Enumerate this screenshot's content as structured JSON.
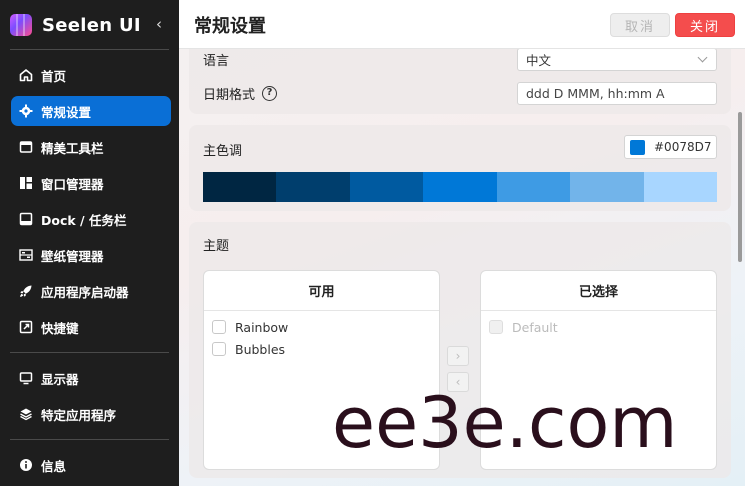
{
  "app": {
    "name": "Seelen UI",
    "collapse_icon": "chevron-left-icon"
  },
  "sidebar": {
    "items": [
      {
        "label": "首页",
        "icon": "home-icon",
        "active": false
      },
      {
        "label": "常规设置",
        "icon": "gear-icon",
        "active": true
      },
      {
        "label": "精美工具栏",
        "icon": "toolbar-icon",
        "active": false
      },
      {
        "label": "窗口管理器",
        "icon": "window-manager-icon",
        "active": false
      },
      {
        "label": "Dock / 任务栏",
        "icon": "dock-icon",
        "active": false
      },
      {
        "label": "壁纸管理器",
        "icon": "wallpaper-icon",
        "active": false
      },
      {
        "label": "应用程序启动器",
        "icon": "rocket-icon",
        "active": false
      },
      {
        "label": "快捷键",
        "icon": "shortcut-icon",
        "active": false
      }
    ],
    "items2": [
      {
        "label": "显示器",
        "icon": "monitor-icon"
      },
      {
        "label": "特定应用程序",
        "icon": "layers-icon"
      }
    ],
    "footer": {
      "label": "信息",
      "icon": "info-icon"
    }
  },
  "header": {
    "title": "常规设置",
    "cancel_label": "取消",
    "close_label": "关闭"
  },
  "general": {
    "language_label": "语言",
    "language_value": "中文",
    "date_format_label": "日期格式",
    "date_format_value": "ddd D MMM, hh:mm A"
  },
  "accent": {
    "label": "主色调",
    "hex": "#0078D7",
    "palette": [
      "#002642",
      "#003e6d",
      "#005aa0",
      "#0078d7",
      "#3e9be4",
      "#72b4ea",
      "#a8d6ff"
    ]
  },
  "theme": {
    "label": "主题",
    "available_title": "可用",
    "selected_title": "已选择",
    "available": [
      "Rainbow",
      "Bubbles"
    ],
    "selected": [
      "Default"
    ]
  },
  "watermark": "ee3e.com"
}
